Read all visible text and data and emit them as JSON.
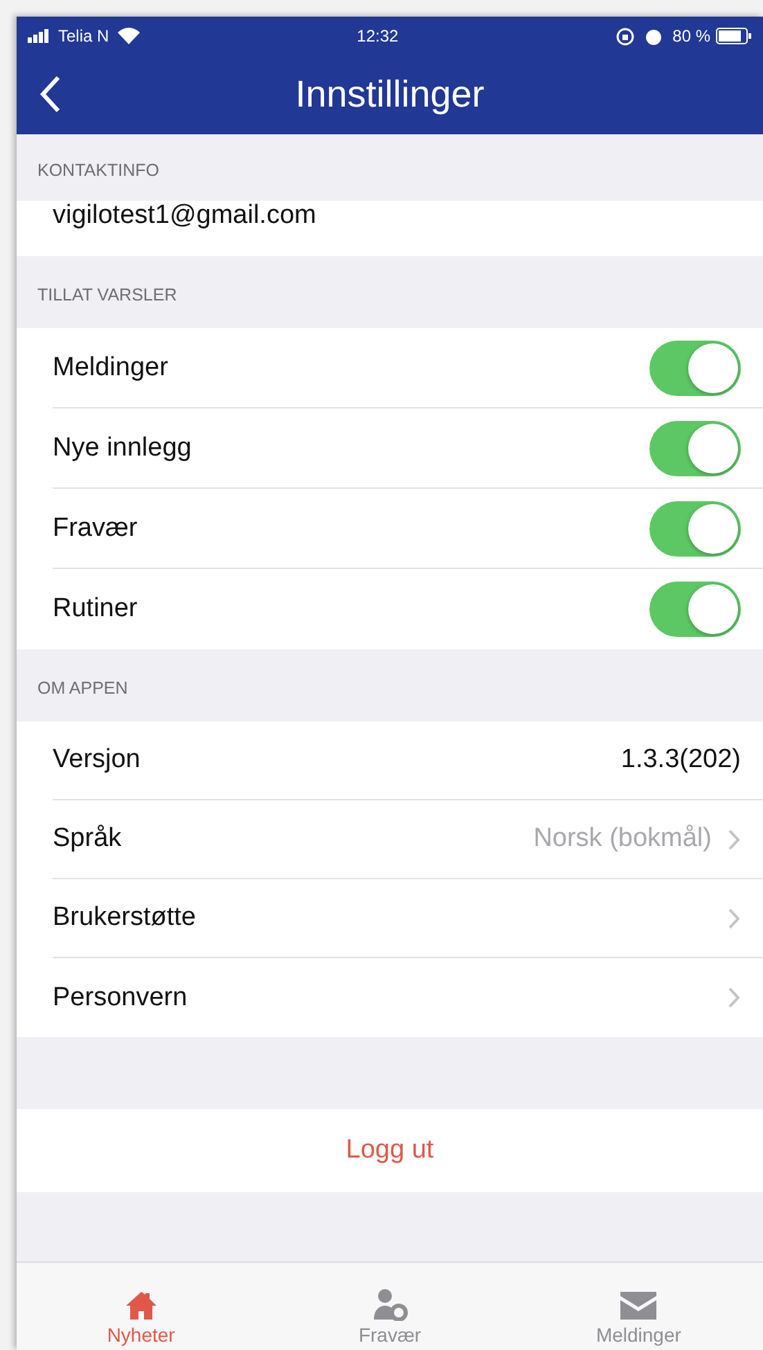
{
  "status_bar": {
    "carrier": "Telia N",
    "time": "12:32",
    "battery": "80 %"
  },
  "nav": {
    "title": "Innstillinger"
  },
  "sections": [
    {
      "header": "KONTAKTINFO",
      "rows": [
        {
          "kind": "text",
          "label": "vigilotest1@gmail.com"
        }
      ]
    },
    {
      "header": "TILLAT VARSLER",
      "rows": [
        {
          "kind": "toggle",
          "label": "Meldinger",
          "on": true
        },
        {
          "kind": "toggle",
          "label": "Nye innlegg",
          "on": true
        },
        {
          "kind": "toggle",
          "label": "Fravær",
          "on": true
        },
        {
          "kind": "toggle",
          "label": "Rutiner",
          "on": true
        }
      ]
    },
    {
      "header": "OM APPEN",
      "rows": [
        {
          "kind": "value",
          "label": "Versjon",
          "value": "1.3.3(202)"
        },
        {
          "kind": "link",
          "label": "Språk",
          "value": "Norsk (bokmål)"
        },
        {
          "kind": "link",
          "label": "Brukerstøtte"
        },
        {
          "kind": "link",
          "label": "Personvern"
        }
      ]
    }
  ],
  "logout": "Logg ut",
  "tabs": [
    {
      "label": "Nyheter",
      "kind": "home",
      "selected": true
    },
    {
      "label": "Fravær",
      "kind": "person",
      "selected": false
    },
    {
      "label": "Meldinger",
      "kind": "mail",
      "selected": false
    }
  ]
}
